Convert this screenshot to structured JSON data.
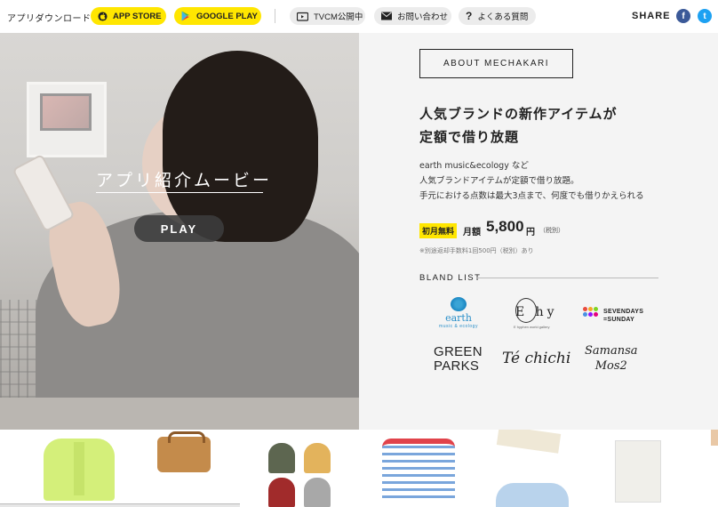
{
  "topbar": {
    "download_label": "アプリダウンロード：",
    "app_store_label": "APP STORE",
    "google_play_label": "GOOGLE PLAY",
    "tvcm_label": "TVCM公開中",
    "contact_label": "お問い合わせ",
    "faq_label": "よくある質問",
    "share_label": "SHARE",
    "facebook_glyph": "f",
    "twitter_glyph": "t"
  },
  "hero": {
    "movie_title": "アプリ紹介ムービー",
    "play_label": "PLAY"
  },
  "about": {
    "button_label": "ABOUT MECHAKARI",
    "headline_line1": "人気ブランドの新作アイテムが",
    "headline_line2": "定額で借り放題",
    "desc_line1": "earth music&ecology など",
    "desc_line2": "人気ブランドアイテムが定額で借り放題。",
    "desc_line3": "手元における点数は最大3点まで、何度でも借りかえられる",
    "free_badge": "初月無料",
    "price_label": "月額",
    "price_value": "5,800",
    "price_unit": "円",
    "tax_note": "（税別）",
    "note": "※別途返却手数料1回500円（税別）あり"
  },
  "brands": {
    "heading": "BLAND LIST",
    "earth_name": "earth",
    "earth_sub": "music & ecology",
    "ehyphen_name": "E hy",
    "ehyphen_sub": "E hyphen world gallery",
    "sevendays_line1": "SEVENDAYS",
    "sevendays_line2": "=SUNDAY",
    "green_line1": "GREEN",
    "green_line2": "PARKS",
    "tech": "Té chichi",
    "samansa_line1": "Samansa",
    "samansa_line2": "Mos2"
  },
  "colors": {
    "accent_yellow": "#ffe600",
    "facebook": "#3b5998",
    "twitter": "#1da1f2"
  }
}
